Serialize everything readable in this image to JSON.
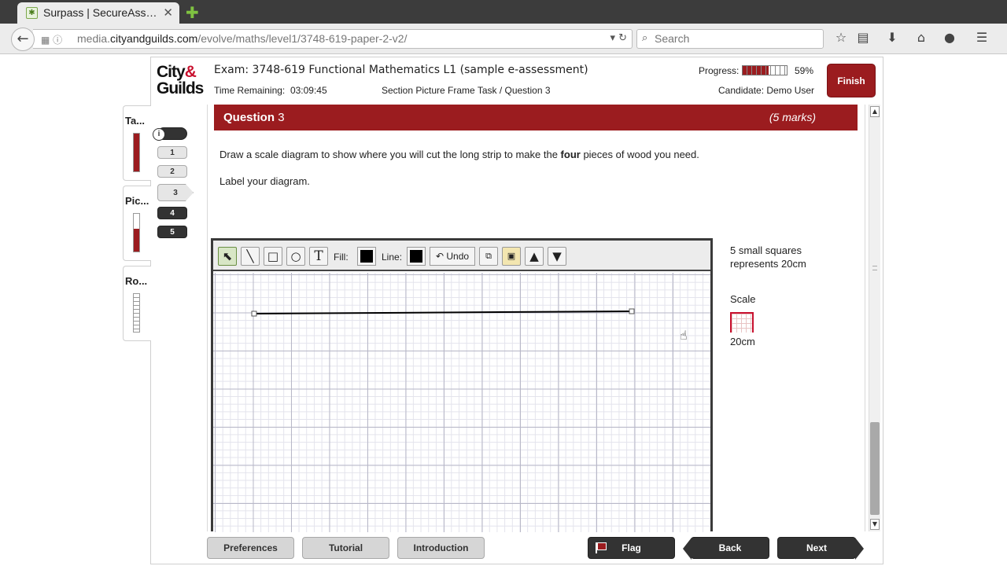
{
  "browser": {
    "tab_title": "Surpass | SecureAss…",
    "tab_close": "✕",
    "url_prefix": "media.",
    "url_domain": "cityandguilds.com",
    "url_path": "/evolve/maths/level1/3748-619-paper-2-v2/",
    "search_placeholder": "Search"
  },
  "header": {
    "logo_line1": "City",
    "logo_amp": "&",
    "logo_line2": "Guilds",
    "exam_title": "Exam: 3748-619 Functional Mathematics L1 (sample e-assessment)",
    "time_remaining_label": "Time Remaining:",
    "time_remaining_value": "03:09:45",
    "section_label": "Section Picture Frame Task / Question 3",
    "progress_label": "Progress:",
    "progress_percent": "59%",
    "progress_value": 0.59,
    "candidate_label": "Candidate: Demo User",
    "finish_label": "Finish"
  },
  "sections": [
    {
      "label": "Ta..."
    },
    {
      "label": "Pic..."
    },
    {
      "label": "Ro..."
    }
  ],
  "questions": {
    "info_icon": "i",
    "items": [
      "1",
      "2",
      "3",
      "4",
      "5"
    ]
  },
  "question": {
    "title_prefix": "Question",
    "number": "3",
    "marks": "(5 marks)",
    "text1_a": "Draw a scale diagram to show where you will cut the long strip to make the ",
    "text1_bold": "four",
    "text1_b": " pieces of wood you need.",
    "text2": "Label your diagram."
  },
  "draw_tool": {
    "fill_label": "Fill:",
    "line_label": "Line:",
    "undo_label": "Undo",
    "select_glyph": "⬉",
    "line_glyph": "╲",
    "rect_glyph": "□",
    "circle_glyph": "○",
    "text_glyph": "T",
    "undo_glyph": "↶",
    "up_glyph": "▲",
    "down_glyph": "▼",
    "fill_color": "#000000",
    "line_color": "#000000"
  },
  "scale": {
    "note_line1": "5 small squares",
    "note_line2": "represents 20cm",
    "title": "Scale",
    "value": "20cm"
  },
  "footer": {
    "preferences": "Preferences",
    "tutorial": "Tutorial",
    "introduction": "Introduction",
    "flag": "Flag",
    "back": "Back",
    "next": "Next"
  },
  "colors": {
    "accent": "#9b1c1f",
    "dark_button": "#333333"
  }
}
